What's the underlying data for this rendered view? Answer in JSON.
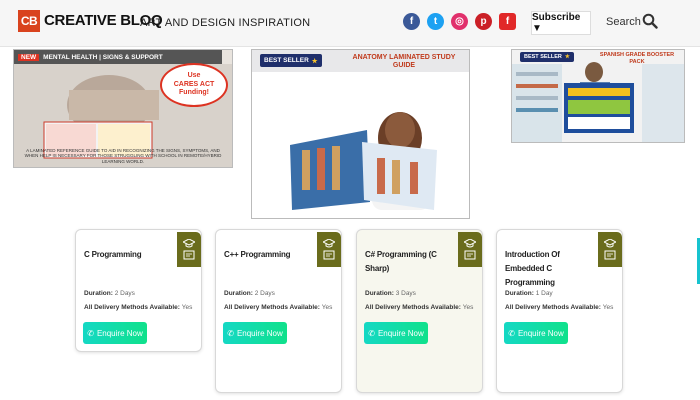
{
  "header": {
    "logo_abbr": "CB",
    "logo_name": "CREATIVE BLOQ",
    "tagline": "ART AND DESIGN INSPIRATION",
    "social": [
      {
        "icon": "facebook-icon",
        "glyph": "f",
        "color": "#3b5998"
      },
      {
        "icon": "twitter-icon",
        "glyph": "t",
        "color": "#1da1f2"
      },
      {
        "icon": "instagram-icon",
        "glyph": "◎",
        "color": "#e1306c"
      },
      {
        "icon": "pinterest-icon",
        "glyph": "p",
        "color": "#cb2027"
      },
      {
        "icon": "flipboard-icon",
        "glyph": "f",
        "color": "#e12828"
      }
    ],
    "subscribe_label": "Subscribe ▼",
    "search_label": "Search"
  },
  "ads": {
    "ad1": {
      "strip_new": "NEW",
      "strip_text": "MENTAL HEALTH | SIGNS & SUPPORT",
      "badge_line1": "Use",
      "badge_line2": "CARES ACT",
      "badge_line3": "Funding!",
      "small_text": "A LAMINATED REFERENCE GUIDE TO AID IN RECOGNIZING THE SIGNS, SYMPTOMS, AND WHEN HELP IS NECESSARY FOR THOSE STRUGGLING WITH SCHOOL IN REMOTE/HYBRID LEARNING WORLD."
    },
    "ad2": {
      "strip_text": "BEST SELLER",
      "title": "ANATOMY LAMINATED STUDY GUIDE"
    },
    "ad3": {
      "strip_text": "BEST SELLER",
      "title": "SPANISH GRADE BOOSTER PACK"
    }
  },
  "courses": [
    {
      "title": "C Programming",
      "duration_label": "Duration:",
      "duration": "2 Days",
      "delivery_label": "All Delivery Methods Available:",
      "delivery": "Yes",
      "button": "Enquire Now"
    },
    {
      "title": "C++ Programming",
      "duration_label": "Duration:",
      "duration": "2 Days",
      "delivery_label": "All Delivery Methods Available:",
      "delivery": "Yes",
      "button": "Enquire Now"
    },
    {
      "title": "C# Programming (C Sharp)",
      "duration_label": "Duration:",
      "duration": "3 Days",
      "delivery_label": "All Delivery Methods Available:",
      "delivery": "Yes",
      "button": "Enquire Now"
    },
    {
      "title": "Introduction Of Embedded C Programming",
      "duration_label": "Duration:",
      "duration": "1 Day",
      "delivery_label": "All Delivery Methods Available:",
      "delivery": "Yes",
      "button": "Enquire Now"
    }
  ],
  "colors": {
    "brand": "#d9431e",
    "card_badge": "#6a6c1c",
    "button_start": "#14d8c4",
    "button_end": "#10e18b"
  }
}
